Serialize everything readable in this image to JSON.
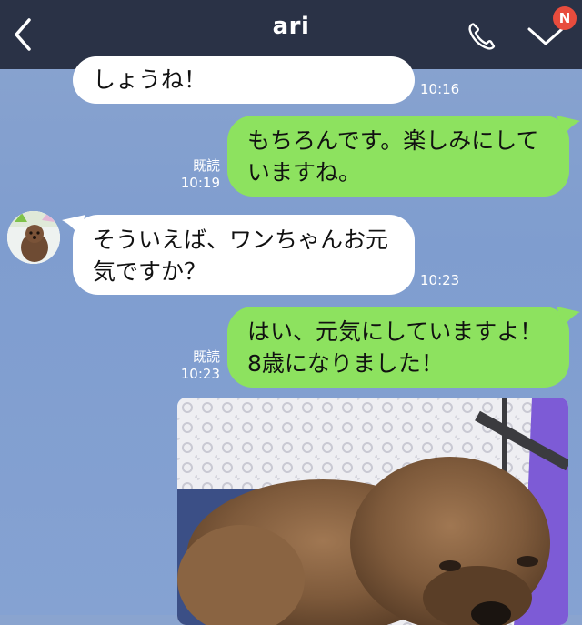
{
  "header": {
    "title": "ari",
    "badge": "N"
  },
  "messages": {
    "m1": {
      "text_line1": "しょうね！",
      "time": "10:16"
    },
    "m2": {
      "text_line1": "もちろんです。楽しみにして",
      "text_line2": "いますね。",
      "read": "既読",
      "time": "10:19"
    },
    "m3": {
      "text_line1": "そういえば、ワンちゃんお元",
      "text_line2": "気ですか？",
      "time": "10:23"
    },
    "m4": {
      "text_line1": "はい、元気にしていますよ！",
      "text_line2": "8歳になりました！",
      "read": "既読",
      "time": "10:23"
    }
  },
  "colors": {
    "header_bg": "#2a3246",
    "chat_bg": "#8aa4cf",
    "outgoing_bubble": "#8de25f",
    "incoming_bubble": "#ffffff",
    "badge": "#e84c3d"
  },
  "icons": [
    "back-chevron-icon",
    "phone-icon",
    "chevron-down-icon",
    "notification-badge",
    "page-indicator-dots"
  ]
}
